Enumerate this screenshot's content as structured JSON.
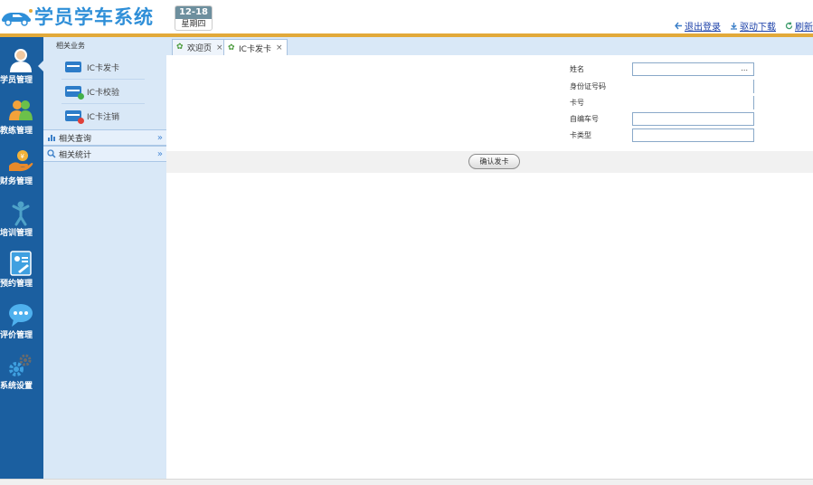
{
  "app": {
    "title": "学员学车系统",
    "date": "12-18",
    "weekday": "星期四",
    "brand_color": "#2f8fd8",
    "accent_color": "#e2a93a",
    "nav_bg_color": "#1b5fa0"
  },
  "top_links": [
    {
      "label": "退出登录",
      "icon": "logout-arrow-icon"
    },
    {
      "label": "驱动下载",
      "icon": "download-icon"
    },
    {
      "label": "刷新",
      "icon": "refresh-icon"
    }
  ],
  "leftnav": {
    "items": [
      {
        "label": "学员管理",
        "icon": "student-person-icon",
        "active": true
      },
      {
        "label": "教练管理",
        "icon": "coach-group-icon"
      },
      {
        "label": "财务管理",
        "icon": "finance-hand-icon"
      },
      {
        "label": "培训管理",
        "icon": "training-figure-icon"
      },
      {
        "label": "预约管理",
        "icon": "booking-card-icon"
      },
      {
        "label": "评价管理",
        "icon": "comment-bubble-icon"
      },
      {
        "label": "系统设置",
        "icon": "settings-gear-icon"
      }
    ]
  },
  "submenu": {
    "title": "相关业务",
    "items": [
      {
        "label": "IC卡发卡",
        "icon": "ic-card-icon"
      },
      {
        "label": "IC卡校验",
        "icon": "ic-card-check-icon"
      },
      {
        "label": "IC卡注销",
        "icon": "ic-card-cancel-icon"
      }
    ],
    "groups": [
      {
        "label": "相关查询",
        "icon": "bar-chart-icon"
      },
      {
        "label": "相关统计",
        "icon": "magnifier-icon"
      }
    ]
  },
  "tabs": [
    {
      "label": "欢迎页",
      "close": "×",
      "active": false
    },
    {
      "label": "IC卡发卡",
      "close": "×",
      "active": true
    }
  ],
  "form": {
    "fields": [
      {
        "label": "姓名",
        "value": "",
        "browse": "..."
      },
      {
        "label": "身份证号码",
        "value": ""
      },
      {
        "label": "卡号",
        "value": ""
      },
      {
        "label": "自编车号",
        "value": ""
      },
      {
        "label": "卡类型",
        "value": ""
      }
    ],
    "confirm_label": "确认发卡"
  }
}
